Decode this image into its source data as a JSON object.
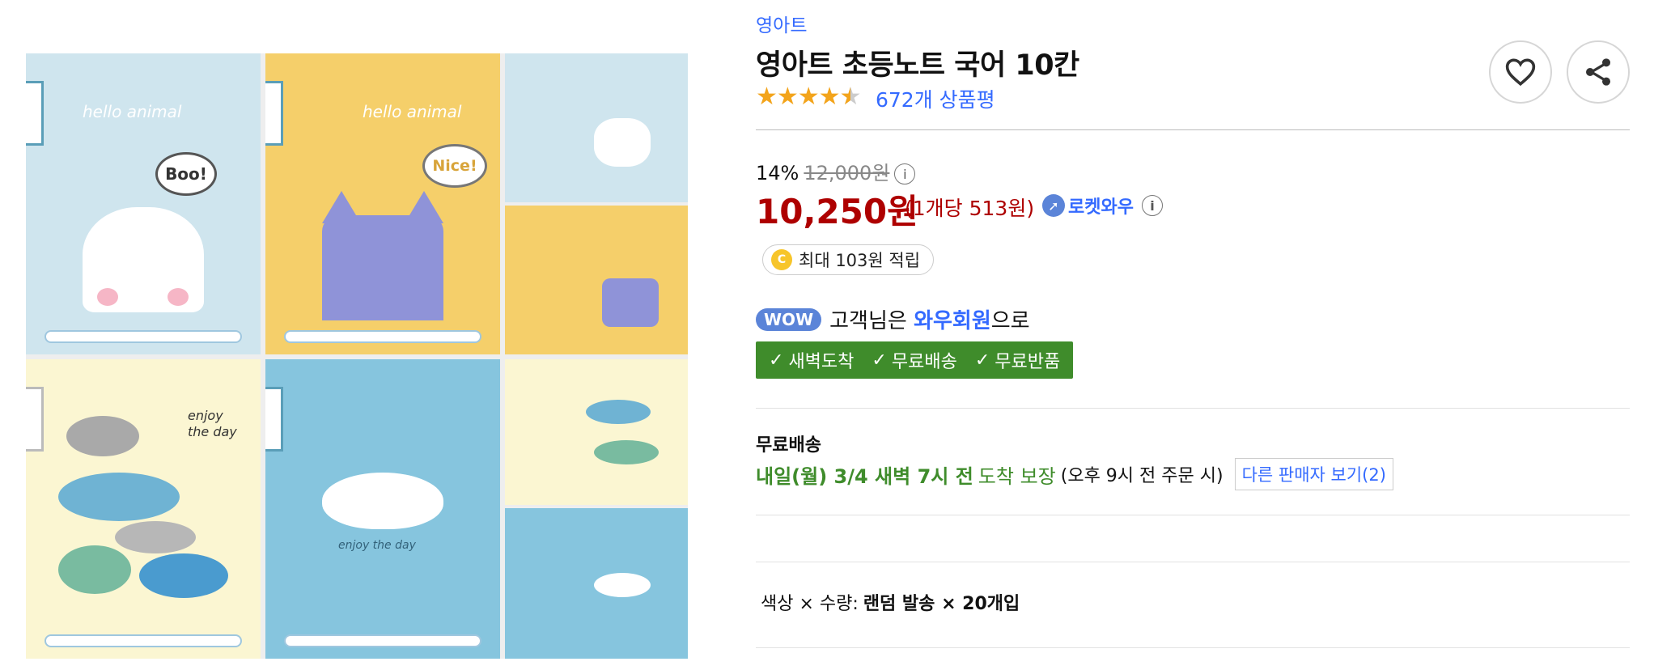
{
  "product": {
    "brand": "영아트",
    "title": "영아트 초등노트 국어 10칸",
    "rating_stars": 4.5,
    "review_count": "672개 상품평"
  },
  "price": {
    "discount_rate": "14%",
    "original_price": "12,000원",
    "sale_price": "10,250원",
    "unit_price": "(1개당 513원)",
    "rocket_label": "로켓와우",
    "info_glyph": "i"
  },
  "cash_reward": {
    "coin_glyph": "C",
    "label": "최대 103원 적립"
  },
  "wow": {
    "badge": "WOW",
    "prefix": "고객님은",
    "member": "와우회원",
    "suffix": "으로",
    "benefits": [
      "새벽도착",
      "무료배송",
      "무료반품"
    ]
  },
  "shipping": {
    "label": "무료배송",
    "eta": "내일(월) 3/4 새벽 7시 전",
    "guarantee": "도착 보장",
    "condition": "(오후 9시 전 주문 시)",
    "other_sellers": "다른 판매자 보기(2)"
  },
  "option": {
    "label": "색상 × 수량:",
    "value": "랜덤 발송 × 20개입"
  },
  "image": {
    "texts": [
      "hello animal",
      "Boo!",
      "Nice!",
      "enjoy the day"
    ]
  },
  "colors": {
    "accent": "#346aff",
    "price_red": "#ae0000",
    "wow_green": "#3f8c2b",
    "star": "#f3a41b"
  }
}
